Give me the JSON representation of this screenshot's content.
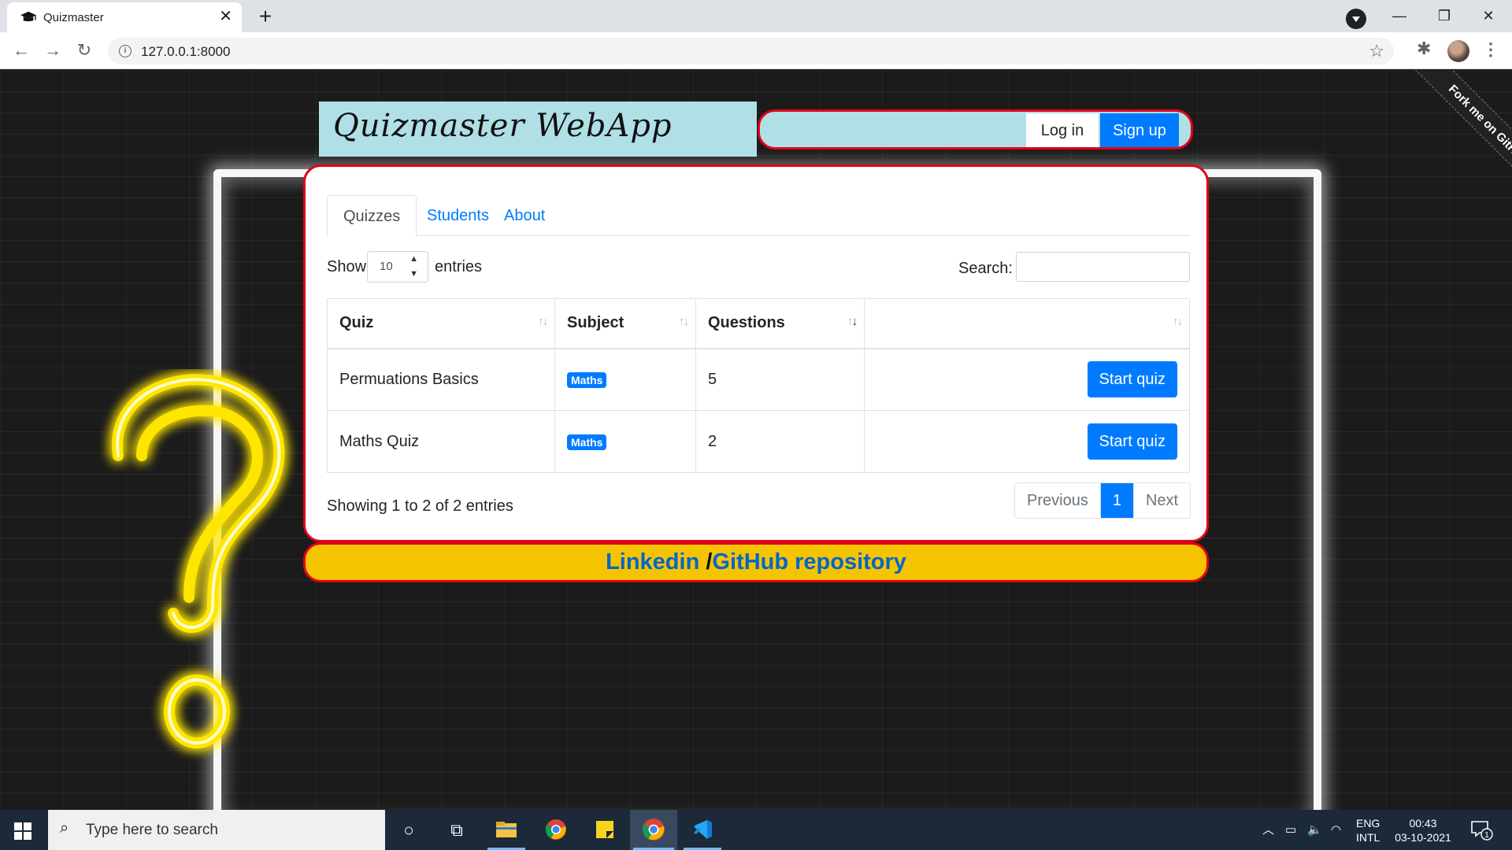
{
  "browser": {
    "tab_title": "Quizmaster",
    "url": "127.0.0.1:8000"
  },
  "page": {
    "brand": "Quizmaster WebApp",
    "fork_ribbon": "Fork me on GitHub",
    "auth": {
      "login": "Log in",
      "signup": "Sign up"
    },
    "tabs": [
      "Quizzes",
      "Students",
      "About"
    ],
    "length_menu": {
      "show": "Show",
      "value": "10",
      "entries": "entries"
    },
    "search_label": "Search:",
    "table": {
      "headers": [
        "Quiz",
        "Subject",
        "Questions",
        ""
      ],
      "rows": [
        {
          "quiz": "Permuations Basics",
          "subject": "Maths",
          "questions": "5",
          "action": "Start quiz"
        },
        {
          "quiz": "Maths Quiz",
          "subject": "Maths",
          "questions": "2",
          "action": "Start quiz"
        }
      ]
    },
    "info": "Showing 1 to 2 of 2 entries",
    "pagination": {
      "previous": "Previous",
      "current": "1",
      "next": "Next"
    },
    "footer": {
      "linkedin": "Linkedin",
      "separator": "/",
      "github": "GitHub repository"
    },
    "colors": {
      "primary": "#007bff",
      "border_red": "#e0001a",
      "brand_bg": "#b0e0e6",
      "footer_bg": "#f5c400",
      "neon_yellow": "#ffe600"
    }
  },
  "taskbar": {
    "search_placeholder": "Type here to search",
    "lang_top": "ENG",
    "lang_bottom": "INTL",
    "time": "00:43",
    "date": "03-10-2021",
    "notification_count": "1"
  }
}
